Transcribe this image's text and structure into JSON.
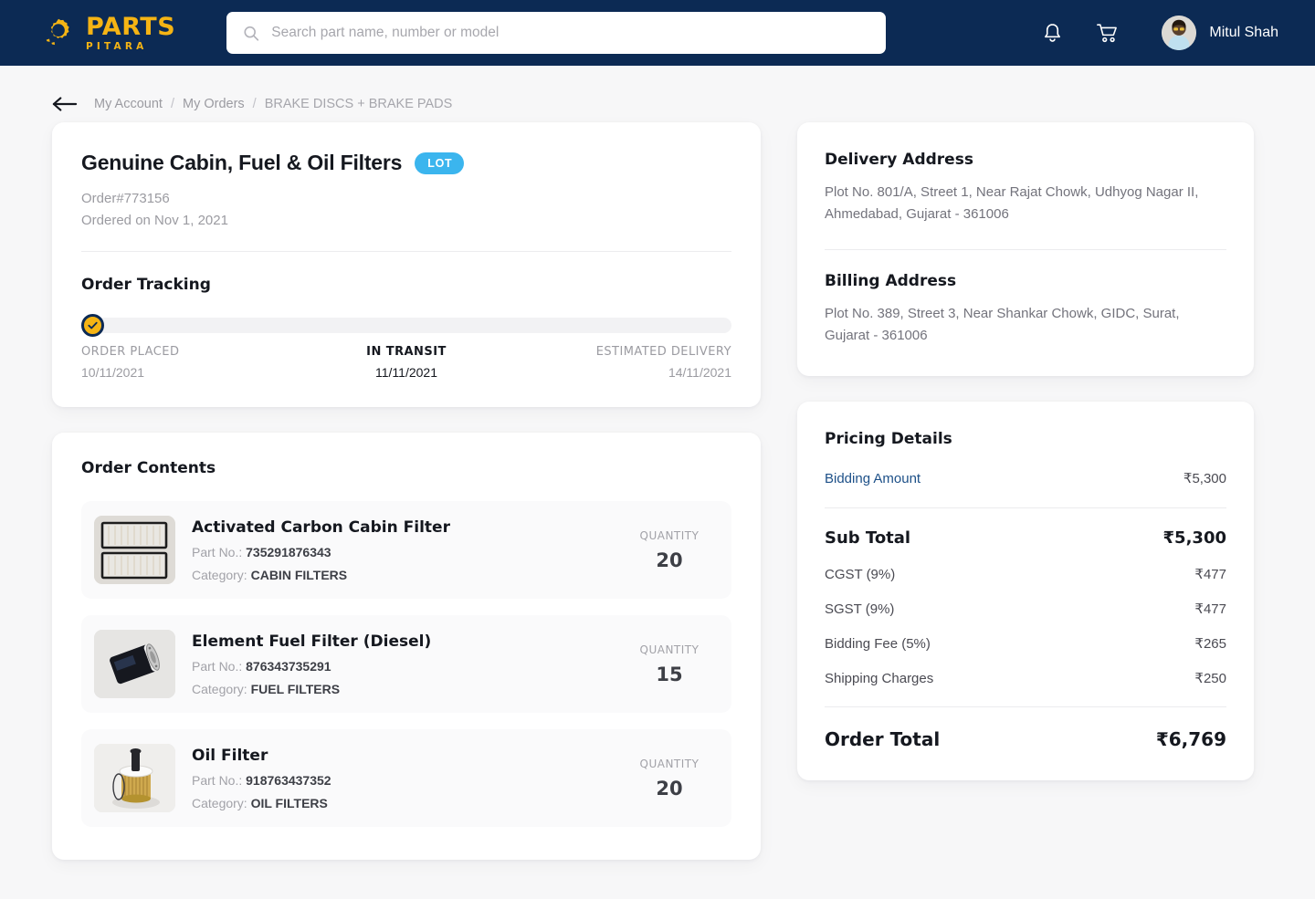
{
  "header": {
    "logo": {
      "main": "PARTS",
      "sub": "PITARA",
      "icon": "gear-icon",
      "color": "#f5b414"
    },
    "search": {
      "placeholder": "Search part name, number or model",
      "value": "",
      "icon": "search-icon"
    },
    "notifications_icon": "bell-icon",
    "cart_icon": "cart-icon",
    "user": {
      "name": "Mitul Shah",
      "avatar": "user-avatar"
    },
    "background": "#0c2a54"
  },
  "breadcrumb": {
    "back_icon": "arrow-left-icon",
    "items": [
      "My Account",
      "My Orders",
      "BRAKE DISCS + BRAKE PADS"
    ],
    "separator": "/"
  },
  "order": {
    "title": "Genuine Cabin, Fuel & Oil Filters",
    "badge": "LOT",
    "badge_color": "#3bb5ee",
    "order_number": "Order#773156",
    "ordered_on": "Ordered on Nov 1, 2021"
  },
  "tracking": {
    "title": "Order Tracking",
    "progress_percent": 0,
    "marker_icon": "check-circle-icon",
    "steps": [
      {
        "label": "ORDER PLACED",
        "date": "10/11/2021",
        "active": false
      },
      {
        "label": "IN TRANSIT",
        "date": "11/11/2021",
        "active": true
      },
      {
        "label": "ESTIMATED DELIVERY",
        "date": "14/11/2021",
        "active": false
      }
    ]
  },
  "contents": {
    "title": "Order Contents",
    "part_label": "Part No.:",
    "category_label": "Category:",
    "quantity_label": "QUANTITY",
    "items": [
      {
        "name": "Activated Carbon Cabin Filter",
        "part_no": "735291876343",
        "category": "CABIN FILTERS",
        "quantity": "20",
        "thumb": "cabin-filter-image"
      },
      {
        "name": "Element Fuel Filter (Diesel)",
        "part_no": "876343735291",
        "category": "FUEL FILTERS",
        "quantity": "15",
        "thumb": "fuel-filter-image"
      },
      {
        "name": "Oil Filter",
        "part_no": "918763437352",
        "category": "OIL FILTERS",
        "quantity": "20",
        "thumb": "oil-filter-image"
      }
    ]
  },
  "delivery": {
    "title": "Delivery Address",
    "address": "Plot No. 801/A, Street 1, Near Rajat Chowk, Udhyog Nagar II, Ahmedabad, Gujarat - 361006"
  },
  "billing": {
    "title": "Billing Address",
    "address": "Plot No. 389, Street 3, Near Shankar Chowk, GIDC, Surat, Gujarat - 361006"
  },
  "pricing": {
    "title": "Pricing Details",
    "bidding_amount_label": "Bidding Amount",
    "bidding_amount_value": "₹5,300",
    "sub_total_label": "Sub Total",
    "sub_total_value": "₹5,300",
    "lines": [
      {
        "label": "CGST (9%)",
        "value": "₹477"
      },
      {
        "label": "SGST (9%)",
        "value": "₹477"
      },
      {
        "label": "Bidding Fee (5%)",
        "value": "₹265"
      },
      {
        "label": "Shipping Charges",
        "value": "₹250"
      }
    ],
    "order_total_label": "Order Total",
    "order_total_value": "₹6,769",
    "link_color": "#1d5088"
  }
}
